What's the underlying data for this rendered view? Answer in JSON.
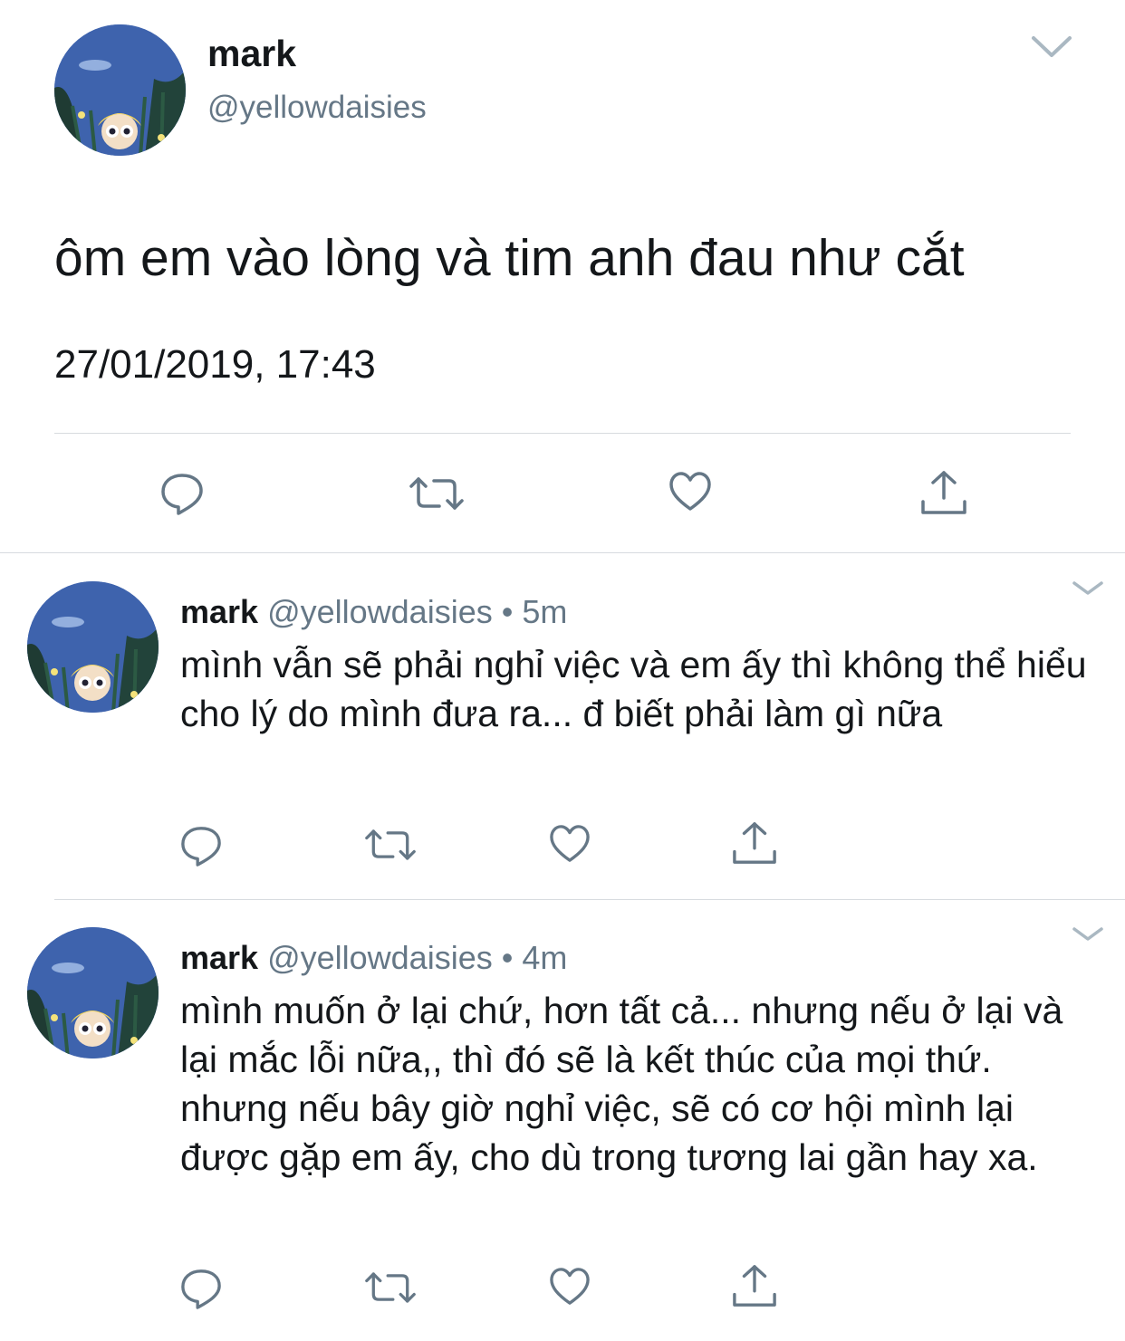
{
  "main_tweet": {
    "avatar": "profile-avatar-cartoon-girl",
    "name": "mark",
    "handle": "@yellowdaisies",
    "text": "ôm em vào lòng và tim anh đau như cắt",
    "timestamp": "27/01/2019, 17:43",
    "menu_icon": "chevron-down-icon",
    "actions": [
      "reply-icon",
      "retweet-icon",
      "like-icon",
      "share-icon"
    ]
  },
  "replies": [
    {
      "name": "mark",
      "handle": "@yellowdaisies",
      "separator": "•",
      "time": "5m",
      "text": "mình vẫn sẽ phải nghỉ việc và em ấy thì không thể hiểu cho lý do mình đưa ra... đ biết phải làm gì nữa"
    },
    {
      "name": "mark",
      "handle": "@yellowdaisies",
      "separator": "•",
      "time": "4m",
      "text": "mình muốn ở lại chứ, hơn tất cả... nhưng nếu ở lại và lại mắc lỗi nữa,, thì đó sẽ là kết thúc của mọi thứ. nhưng nếu bây giờ nghỉ việc, sẽ có cơ hội mình lại được gặp em ấy, cho dù trong tương lai gần hay xa."
    }
  ],
  "colors": {
    "text_primary": "#14171a",
    "text_secondary": "#657786",
    "icon_gray": "#657786",
    "divider": "#d7dbdf",
    "avatar_sky": "#3f66b3"
  }
}
